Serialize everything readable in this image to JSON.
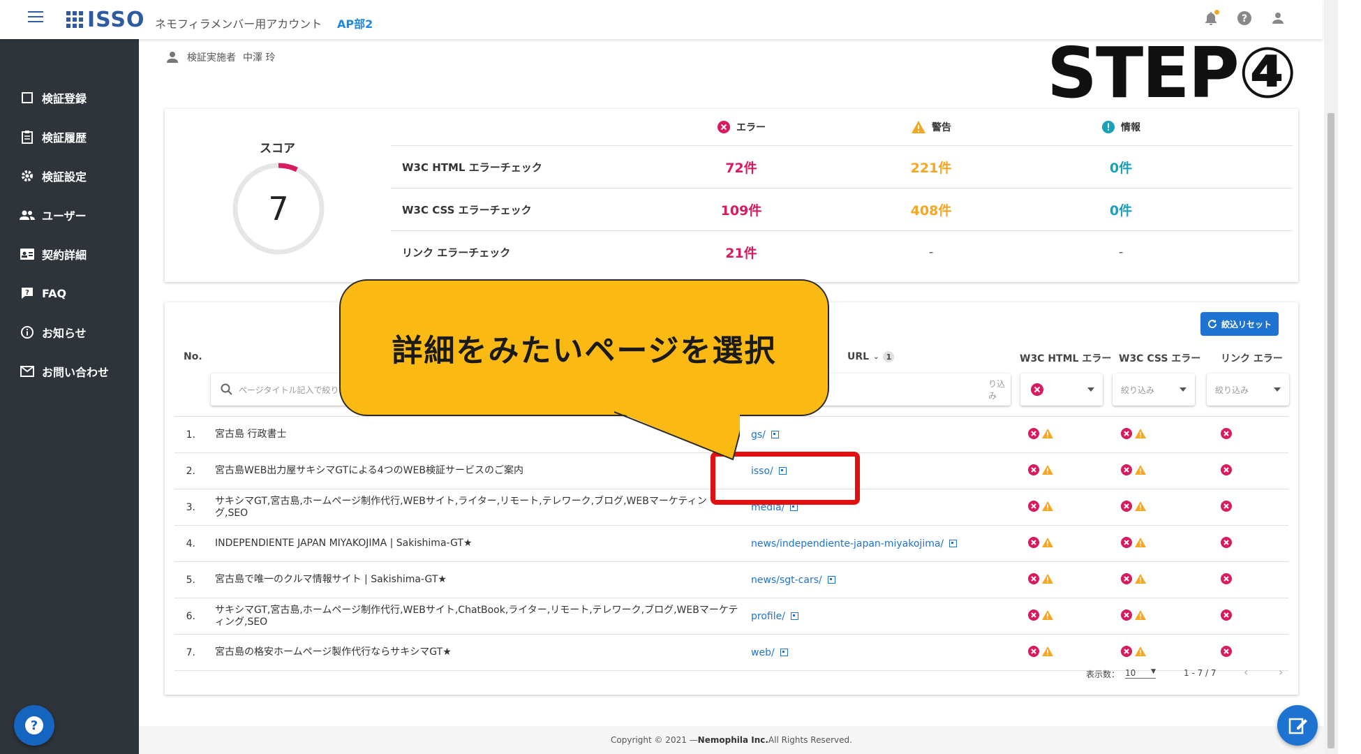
{
  "header": {
    "logo_text": "ISSO",
    "account_name": "ネモフィラメンバー用アカウント",
    "department": "AP部2",
    "icons": [
      "bell-icon",
      "help-icon",
      "user-icon"
    ],
    "accent_color": "#2e5aa0"
  },
  "sidebar": {
    "items": [
      {
        "label": "検証登録",
        "icon": "checkbox-icon"
      },
      {
        "label": "検証履歴",
        "icon": "clipboard-icon"
      },
      {
        "label": "検証設定",
        "icon": "gear-icon"
      },
      {
        "label": "ユーザー",
        "icon": "users-icon"
      },
      {
        "label": "契約詳細",
        "icon": "id-card-icon"
      },
      {
        "label": "FAQ",
        "icon": "faq-icon"
      },
      {
        "label": "お知らせ",
        "icon": "info-icon"
      },
      {
        "label": "お問い合わせ",
        "icon": "mail-icon"
      }
    ],
    "background": "#2e3439"
  },
  "inspector": {
    "label": "検証実施者",
    "name": "中澤 玲"
  },
  "overlay": {
    "step": "STEP④",
    "callout": "詳細をみたいページを選択",
    "callout_color": "#fbb913",
    "highlight_color": "#e11010"
  },
  "summary": {
    "score_label": "スコア",
    "score": "7",
    "score_fraction": 0.07,
    "headers": {
      "error": "エラー",
      "warning": "警告",
      "info": "情報"
    },
    "rows": [
      {
        "label": "W3C HTML エラーチェック",
        "error": "72件",
        "warning": "221件",
        "info": "0件"
      },
      {
        "label": "W3C CSS エラーチェック",
        "error": "109件",
        "warning": "408件",
        "info": "0件"
      },
      {
        "label": "リンク エラーチェック",
        "error": "21件",
        "warning": "-",
        "info": "-"
      }
    ]
  },
  "list": {
    "reset_label": "絞込リセット",
    "col_no": "No.",
    "col_url": "URL",
    "url_sort_badge": "1",
    "col_html": "W3C HTML エラー",
    "col_css": "W3C CSS エラー",
    "col_link": "リンク エラー",
    "title_filter_placeholder": "ページタイトル記入で絞り込み",
    "url_filter_placeholder": "り込み",
    "css_filter": "絞り込み",
    "link_filter": "絞り込み",
    "rows": [
      {
        "no": "1.",
        "title": "宮古島 行政書士",
        "url": "gs/"
      },
      {
        "no": "2.",
        "title": "宮古島WEB出力屋サキシマGTによる4つのWEB検証サービスのご案内",
        "url": "isso/"
      },
      {
        "no": "3.",
        "title": "サキシマGT,宮古島,ホームページ制作代行,WEBサイト,ライター,リモート,テレワーク,ブログ,WEBマーケティング,SEO",
        "url": "media/"
      },
      {
        "no": "4.",
        "title": "INDEPENDIENTE JAPAN MIYAKOJIMA | Sakishima-GT★",
        "url": "news/independiente-japan-miyakojima/"
      },
      {
        "no": "5.",
        "title": "宮古島で唯一のクルマ情報サイト | Sakishima-GT★",
        "url": "news/sgt-cars/"
      },
      {
        "no": "6.",
        "title": "サキシマGT,宮古島,ホームページ制作代行,WEBサイト,ChatBook,ライター,リモート,テレワーク,ブログ,WEBマーケティング,SEO",
        "url": "profile/"
      },
      {
        "no": "7.",
        "title": "宮古島の格安ホームページ製作代行ならサキシマGT★",
        "url": "web/"
      }
    ],
    "pager": {
      "per_page_label": "表示数：",
      "per_page": "10",
      "range": "1 - 7 / 7"
    }
  },
  "footer": {
    "prefix": "Copyright © 2021 — ",
    "company": "Nemophila Inc.",
    "suffix": " All Rights Reserved."
  }
}
